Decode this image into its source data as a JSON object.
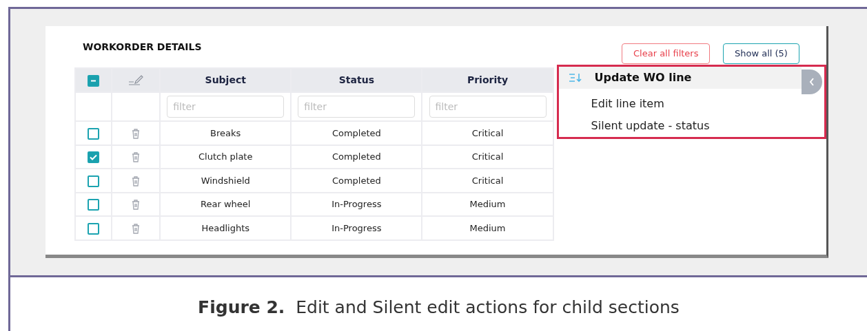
{
  "section": {
    "title": "WORKORDER DETAILS"
  },
  "buttons": [
    {
      "label": "Clear all filters",
      "kind": "danger"
    },
    {
      "label": "Show all (5)",
      "kind": "info"
    }
  ],
  "table": {
    "select_all": {
      "indeterminate": true
    },
    "columns": [
      {
        "label": "Subject",
        "placeholder": "filter"
      },
      {
        "label": "Status",
        "placeholder": "filter"
      },
      {
        "label": "Priority",
        "placeholder": "filter"
      }
    ],
    "rows": [
      {
        "checked": false,
        "cells": [
          "Breaks",
          "Completed",
          "Critical"
        ]
      },
      {
        "checked": true,
        "cells": [
          "Clutch plate",
          "Completed",
          "Critical"
        ]
      },
      {
        "checked": false,
        "cells": [
          "Windshield",
          "Completed",
          "Critical"
        ]
      },
      {
        "checked": false,
        "cells": [
          "Rear wheel",
          "In-Progress",
          "Medium"
        ]
      },
      {
        "checked": false,
        "cells": [
          "Headlights",
          "In-Progress",
          "Medium"
        ]
      }
    ]
  },
  "menu": {
    "title": "Update WO line",
    "highlighted": true,
    "items": [
      "Edit line item",
      "Silent update - status"
    ]
  },
  "caption": {
    "text": "**Figure 2.**  Edit and Silent edit actions for child sections"
  }
}
